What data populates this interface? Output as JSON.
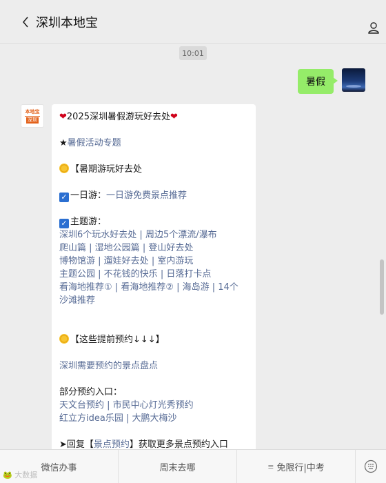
{
  "window": {
    "minimize": "—",
    "maximize": "☐",
    "close": "✕"
  },
  "header": {
    "title": "深圳本地宝"
  },
  "chat": {
    "time": "10:01",
    "outgoing": {
      "text": "暑假"
    },
    "bot_avatar": {
      "line1": "本地宝",
      "line2": "深圳"
    },
    "message": {
      "title_heart_left": "❤",
      "title": "2025深圳暑假游玩好去处",
      "title_heart_right": "❤",
      "special_prefix": "★",
      "special_link": "暑假活动专题",
      "section1": "【暑期游玩好去处",
      "day_trip_label": "一日游：",
      "day_trip_link": "一日游免费景点推荐",
      "theme_label": "主题游：",
      "theme_links": [
        [
          "深圳6个玩水好去处",
          "周边5个漂流/瀑布"
        ],
        [
          "爬山篇",
          "湿地公园篇",
          "登山好去处"
        ],
        [
          "博物馆游",
          "遛娃好去处",
          "室内游玩"
        ],
        [
          "主题公园",
          "不花钱的快乐",
          "日落打卡点"
        ],
        [
          "看海地推荐①",
          "看海地推荐②",
          "海岛游",
          "14个"
        ],
        [
          "沙滩推荐"
        ]
      ],
      "section2": "【这些提前预约↓↓↓】",
      "booking_link": "深圳需要预约的景点盘点",
      "entry_label": "部分预约入口：",
      "entry_links": [
        [
          "天文台预约",
          "市民中心灯光秀预约"
        ],
        [
          "红立方idea乐园",
          "大鹏大梅沙"
        ]
      ],
      "reply_prefix": "➤回复【",
      "reply_link": "景点预约",
      "reply_suffix": "】获取更多景点预约入口"
    }
  },
  "menu": {
    "item1": "微信办事",
    "item2": "周末去哪",
    "item3_icon": "≡",
    "item3": "免限行|中考"
  },
  "watermark": "🐸 大数据",
  "icons": {
    "back": "chevron-left-icon",
    "profile": "person-icon",
    "keyboard": "keyboard-icon"
  },
  "colors": {
    "bubble_out": "#95ec69",
    "link": "#576b95",
    "background": "#ededed"
  }
}
